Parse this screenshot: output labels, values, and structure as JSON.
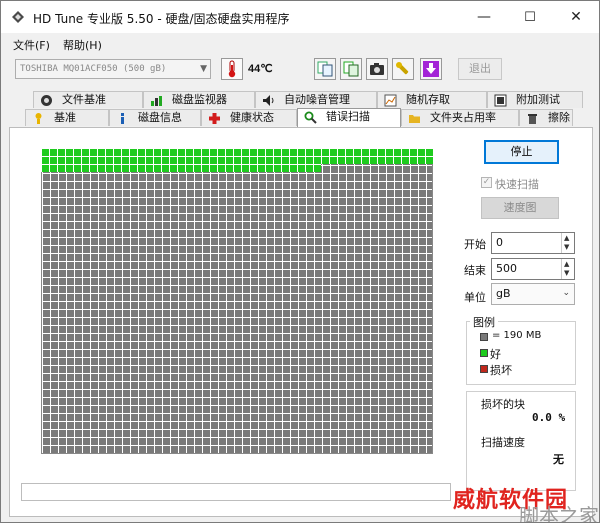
{
  "window": {
    "title": "HD Tune 专业版 5.50 - 硬盘/固态硬盘实用程序",
    "controls": {
      "minimize": "—",
      "maximize": "☐",
      "close": "✕"
    }
  },
  "menu": {
    "items": [
      "文件(F)",
      "帮助(H)"
    ]
  },
  "toolbar": {
    "drive": "TOSHIBA MQ01ACF050 (500 gB)",
    "temperature": "44℃",
    "buttons": [
      "copy-info-icon",
      "copy-screen-icon",
      "camera-icon",
      "tools-icon",
      "download-icon"
    ],
    "exit_label": "退出"
  },
  "tabs": {
    "row1": [
      "文件基准",
      "磁盘监视器",
      "自动噪音管理",
      "随机存取",
      "附加测试"
    ],
    "row2": [
      "基准",
      "磁盘信息",
      "健康状态",
      "错误扫描",
      "文件夹占用率",
      "擦除"
    ],
    "active": "错误扫描"
  },
  "scan": {
    "stop_label": "停止",
    "quick_scan_label": "快速扫描",
    "speed_map_label": "速度图",
    "start_label": "开始",
    "start_value": "0",
    "end_label": "结束",
    "end_value": "500",
    "unit_label": "单位",
    "unit_value": "gB",
    "progress_fraction": 0.044
  },
  "legend": {
    "title": "图例",
    "block_size": "= 190 MB",
    "good": "好",
    "bad": "损坏",
    "colors": {
      "unscanned": "#7a7a7a",
      "good": "#1ecb1e",
      "bad": "#c0281c"
    }
  },
  "stats": {
    "damaged_label": "损坏的块",
    "damaged_value": "0.0 %",
    "speed_label": "扫描速度",
    "speed_value": "无"
  },
  "watermark": {
    "line1": "威航软件园",
    "line2": "脚本之家"
  }
}
